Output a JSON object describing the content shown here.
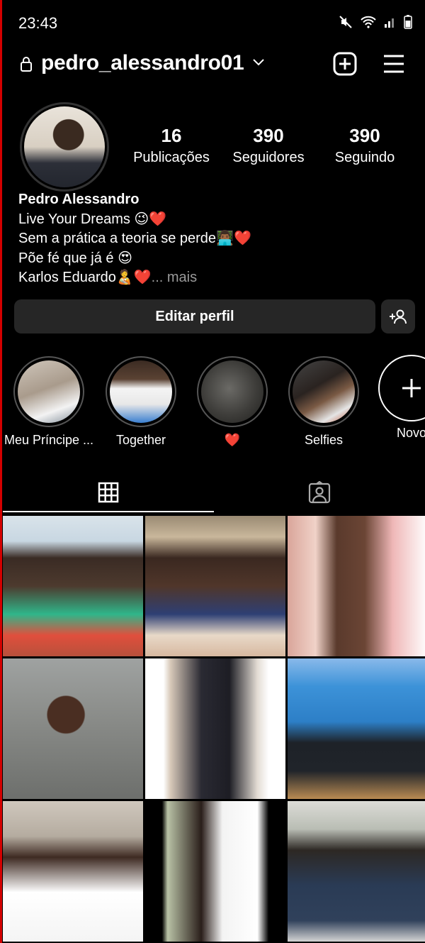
{
  "status_bar": {
    "time": "23:43"
  },
  "header": {
    "username": "pedro_alessandro01"
  },
  "profile": {
    "posts": {
      "count": "16",
      "label": "Publicações"
    },
    "followers": {
      "count": "390",
      "label": "Seguidores"
    },
    "following": {
      "count": "390",
      "label": "Seguindo"
    },
    "name": "Pedro Alessandro",
    "bio_line1": "Live Your Dreams 😉❤️",
    "bio_line2": "Sem a prática a teoria se perde👨🏾‍💻❤️",
    "bio_line3": "Põe fé que já é 😍",
    "bio_line4": "Karlos Eduardo🧑‍🍼❤️",
    "more_label": "... mais"
  },
  "actions": {
    "edit_profile": "Editar perfil"
  },
  "highlights": [
    {
      "label": "Meu Príncipe ..."
    },
    {
      "label": "Together"
    },
    {
      "label": "❤️"
    },
    {
      "label": "Selfies"
    }
  ],
  "new_highlight": {
    "label": "Novo"
  },
  "tabs": [
    "grid-icon",
    "tagged-icon"
  ],
  "colors": {
    "background": "#000000",
    "button": "#262626",
    "muted": "#9a9a9a",
    "accent_red": "#d40000"
  }
}
